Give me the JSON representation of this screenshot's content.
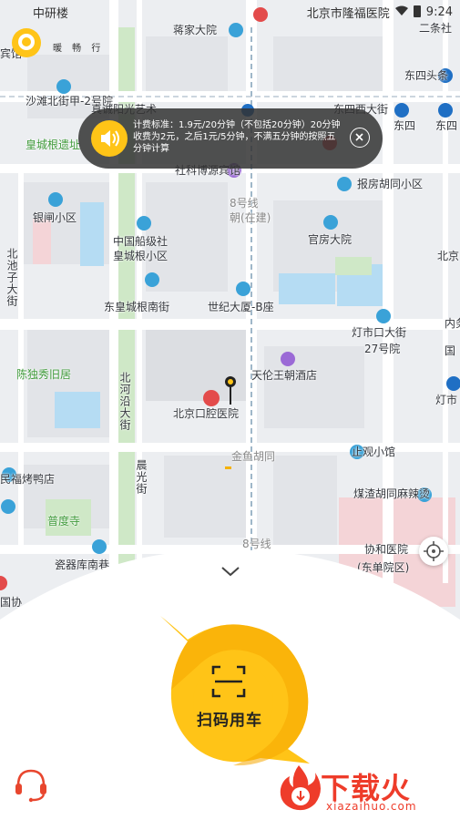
{
  "status_bar": {
    "left_text": "中研楼",
    "hospital": "北京市隆福医院",
    "time": "9:24"
  },
  "app": {
    "logo_text": "暖 畅 行"
  },
  "notice": {
    "text": "计费标准：1.9元/20分钟（不包括20分钟）20分钟收费为2元，之后1元/5分钟，不满五分钟的按照五分钟计算"
  },
  "map": {
    "labels": [
      {
        "text": "蒋家大院",
        "cls": ""
      },
      {
        "text": "二条社",
        "cls": ""
      },
      {
        "text": "宾馆",
        "cls": ""
      },
      {
        "text": "东四头条",
        "cls": ""
      },
      {
        "text": "沙滩北街甲-2号院",
        "cls": ""
      },
      {
        "text": "东四西大街",
        "cls": ""
      },
      {
        "text": "东四",
        "cls": ""
      },
      {
        "text": "东四",
        "cls": ""
      },
      {
        "text": "真诚阳光艺术",
        "cls": ""
      },
      {
        "text": "皇城根遗址",
        "cls": "green"
      },
      {
        "text": "社科博源宾馆",
        "cls": ""
      },
      {
        "text": "报房胡同小区",
        "cls": ""
      },
      {
        "text": "8号线",
        "cls": "grey"
      },
      {
        "text": "朝(在建)",
        "cls": "grey"
      },
      {
        "text": "银闸小区",
        "cls": ""
      },
      {
        "text": "官房大院",
        "cls": ""
      },
      {
        "text": "中国船级社",
        "cls": ""
      },
      {
        "text": "皇城根小区",
        "cls": ""
      },
      {
        "text": "北京",
        "cls": ""
      },
      {
        "text": "北池子大街",
        "cls": ""
      },
      {
        "text": "东皇城根南街",
        "cls": ""
      },
      {
        "text": "世纪大厦-B座",
        "cls": ""
      },
      {
        "text": "灯市口大街",
        "cls": ""
      },
      {
        "text": "27号院",
        "cls": ""
      },
      {
        "text": "内务",
        "cls": ""
      },
      {
        "text": "国",
        "cls": ""
      },
      {
        "text": "陈独秀旧居",
        "cls": "green"
      },
      {
        "text": "天伦王朝酒店",
        "cls": ""
      },
      {
        "text": "灯市",
        "cls": ""
      },
      {
        "text": "北京口腔医院",
        "cls": ""
      },
      {
        "text": "北河沿大街",
        "cls": ""
      },
      {
        "text": "金鱼胡同",
        "cls": "grey"
      },
      {
        "text": "止观小馆",
        "cls": ""
      },
      {
        "text": "民福烤鸭店",
        "cls": ""
      },
      {
        "text": "晨光街",
        "cls": ""
      },
      {
        "text": "煤渣胡同麻辣烫",
        "cls": ""
      },
      {
        "text": "普度寺",
        "cls": "green"
      },
      {
        "text": "8号线",
        "cls": "grey"
      },
      {
        "text": "协和医院",
        "cls": ""
      },
      {
        "text": "(东单院区)",
        "cls": ""
      },
      {
        "text": "瓷器库南巷",
        "cls": ""
      },
      {
        "text": "国协",
        "cls": ""
      }
    ]
  },
  "actions": {
    "scan_label": "扫码用车"
  },
  "watermark": {
    "main": "下载火",
    "sub": "xiazaihuo.com"
  },
  "icons": {
    "notice": "speaker-icon",
    "close": "close-icon",
    "locate": "locate-icon",
    "service": "headset-icon",
    "expand": "chevron-down-icon",
    "scan": "scan-icon"
  },
  "colors": {
    "brand_yellow": "#ffc417",
    "watermark_red": "#ee3c2a",
    "park_green": "#cfe8c7",
    "water_blue": "#b5dcf3",
    "hospital_pink": "#f4d4d7"
  }
}
